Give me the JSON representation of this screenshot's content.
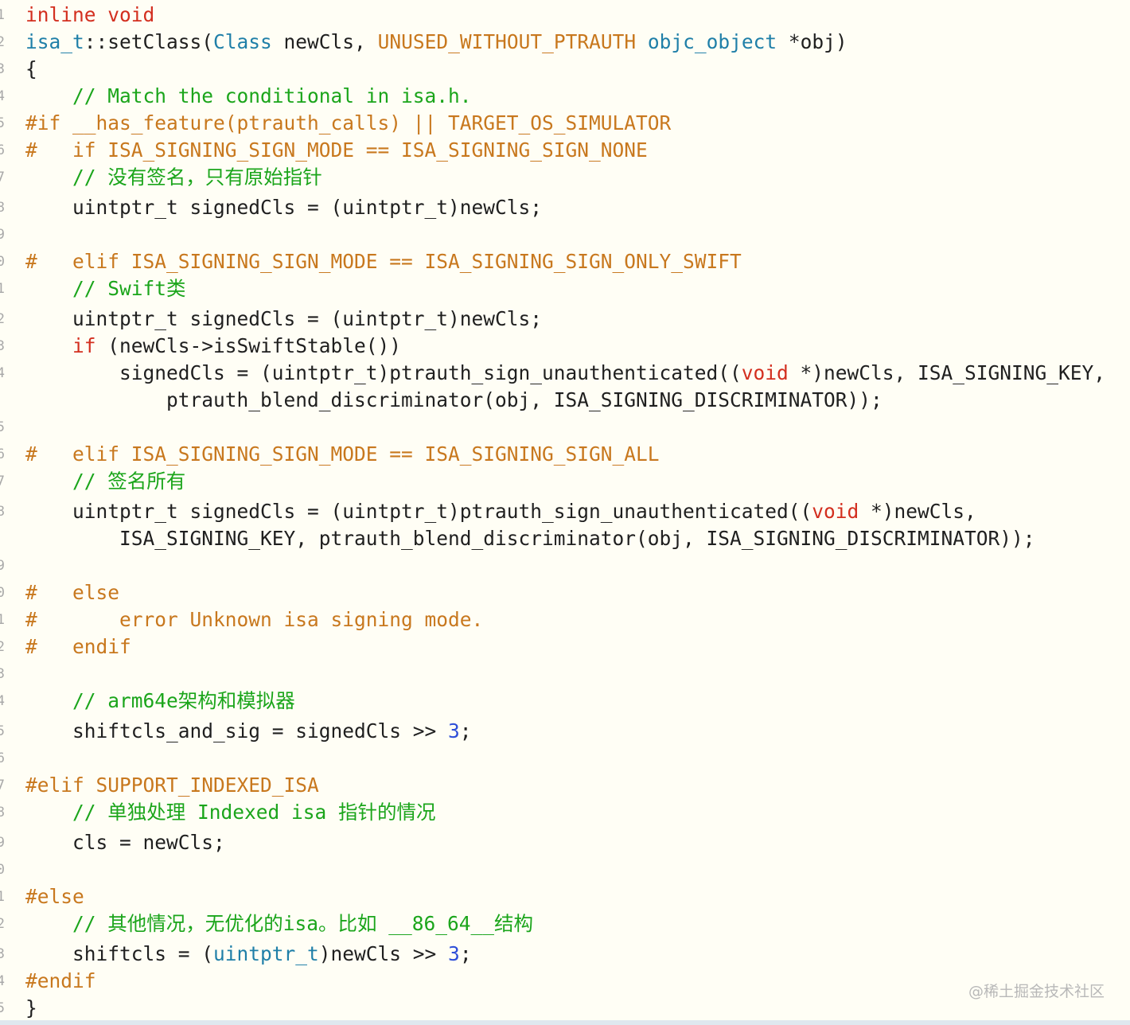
{
  "editor": {
    "lines": [
      {
        "n": "1",
        "tokens": [
          {
            "t": "inline void",
            "k": "keyword"
          }
        ]
      },
      {
        "n": "2",
        "tokens": [
          {
            "t": "isa_t",
            "k": "type"
          },
          {
            "t": "::setClass(",
            "k": "plain"
          },
          {
            "t": "Class",
            "k": "type"
          },
          {
            "t": " newCls, ",
            "k": "plain"
          },
          {
            "t": "UNUSED_WITHOUT_PTRAUTH",
            "k": "macro"
          },
          {
            "t": " ",
            "k": "plain"
          },
          {
            "t": "objc_object",
            "k": "type"
          },
          {
            "t": " *obj)",
            "k": "plain"
          }
        ]
      },
      {
        "n": "3",
        "tokens": [
          {
            "t": "{",
            "k": "plain"
          }
        ]
      },
      {
        "n": "4",
        "tokens": [
          {
            "t": "    // Match the conditional in isa.h.",
            "k": "comment"
          }
        ]
      },
      {
        "n": "5",
        "tokens": [
          {
            "t": "#if __has_feature(ptrauth_calls) || TARGET_OS_SIMULATOR",
            "k": "preproc"
          }
        ]
      },
      {
        "n": "6",
        "tokens": [
          {
            "t": "#   if ISA_SIGNING_SIGN_MODE == ISA_SIGNING_SIGN_NONE",
            "k": "preproc"
          }
        ]
      },
      {
        "n": "7",
        "tokens": [
          {
            "t": "    // 没有签名，只有原始指针",
            "k": "comment"
          }
        ]
      },
      {
        "n": "8",
        "tokens": [
          {
            "t": "    uintptr_t signedCls = (uintptr_t)newCls;",
            "k": "plain"
          }
        ]
      },
      {
        "n": "9",
        "tokens": []
      },
      {
        "n": "0",
        "tokens": [
          {
            "t": "#   elif ISA_SIGNING_SIGN_MODE == ISA_SIGNING_SIGN_ONLY_SWIFT",
            "k": "preproc"
          }
        ]
      },
      {
        "n": "1",
        "tokens": [
          {
            "t": "    // Swift类",
            "k": "comment"
          }
        ]
      },
      {
        "n": "2",
        "tokens": [
          {
            "t": "    uintptr_t signedCls = (uintptr_t)newCls;",
            "k": "plain"
          }
        ]
      },
      {
        "n": "3",
        "tokens": [
          {
            "t": "    ",
            "k": "plain"
          },
          {
            "t": "if",
            "k": "keyword"
          },
          {
            "t": " (newCls->isSwiftStable())",
            "k": "plain"
          }
        ]
      },
      {
        "n": "4",
        "tokens": [
          {
            "t": "        signedCls = (uintptr_t)ptrauth_sign_unauthenticated((",
            "k": "plain"
          },
          {
            "t": "void",
            "k": "keyword"
          },
          {
            "t": " *)newCls, ISA_SIGNING_KEY,",
            "k": "plain"
          }
        ]
      },
      {
        "n": "",
        "tokens": [
          {
            "t": "            ptrauth_blend_discriminator(obj, ISA_SIGNING_DISCRIMINATOR));",
            "k": "plain"
          }
        ]
      },
      {
        "n": "5",
        "tokens": []
      },
      {
        "n": "6",
        "tokens": [
          {
            "t": "#   elif ISA_SIGNING_SIGN_MODE == ISA_SIGNING_SIGN_ALL",
            "k": "preproc"
          }
        ]
      },
      {
        "n": "7",
        "tokens": [
          {
            "t": "    // 签名所有",
            "k": "comment"
          }
        ]
      },
      {
        "n": "8",
        "tokens": [
          {
            "t": "    uintptr_t signedCls = (uintptr_t)ptrauth_sign_unauthenticated((",
            "k": "plain"
          },
          {
            "t": "void",
            "k": "keyword"
          },
          {
            "t": " *)newCls,",
            "k": "plain"
          }
        ]
      },
      {
        "n": "",
        "tokens": [
          {
            "t": "        ISA_SIGNING_KEY, ptrauth_blend_discriminator(obj, ISA_SIGNING_DISCRIMINATOR));",
            "k": "plain"
          }
        ]
      },
      {
        "n": "9",
        "tokens": []
      },
      {
        "n": "0",
        "tokens": [
          {
            "t": "#   else",
            "k": "preproc"
          }
        ]
      },
      {
        "n": "1",
        "tokens": [
          {
            "t": "#       error Unknown isa signing mode.",
            "k": "preproc"
          }
        ]
      },
      {
        "n": "2",
        "tokens": [
          {
            "t": "#   endif",
            "k": "preproc"
          }
        ]
      },
      {
        "n": "3",
        "tokens": []
      },
      {
        "n": "4",
        "tokens": [
          {
            "t": "    // arm64e架构和模拟器",
            "k": "comment"
          }
        ]
      },
      {
        "n": "5",
        "tokens": [
          {
            "t": "    shiftcls_and_sig = signedCls >> ",
            "k": "plain"
          },
          {
            "t": "3",
            "k": "number"
          },
          {
            "t": ";",
            "k": "plain"
          }
        ]
      },
      {
        "n": "6",
        "tokens": []
      },
      {
        "n": "7",
        "tokens": [
          {
            "t": "#elif SUPPORT_INDEXED_ISA",
            "k": "preproc"
          }
        ]
      },
      {
        "n": "8",
        "tokens": [
          {
            "t": "    // 单独处理 Indexed isa 指针的情况",
            "k": "comment"
          }
        ]
      },
      {
        "n": "9",
        "tokens": [
          {
            "t": "    cls = newCls;",
            "k": "plain"
          }
        ]
      },
      {
        "n": "0",
        "tokens": []
      },
      {
        "n": "1",
        "tokens": [
          {
            "t": "#else",
            "k": "preproc"
          }
        ]
      },
      {
        "n": "2",
        "tokens": [
          {
            "t": "    // 其他情况，无优化的isa。比如 __86_64__结构",
            "k": "comment"
          }
        ]
      },
      {
        "n": "3",
        "tokens": [
          {
            "t": "    shiftcls = (",
            "k": "plain"
          },
          {
            "t": "uintptr_t",
            "k": "type"
          },
          {
            "t": ")newCls >> ",
            "k": "plain"
          },
          {
            "t": "3",
            "k": "number"
          },
          {
            "t": ";",
            "k": "plain"
          }
        ]
      },
      {
        "n": "4",
        "tokens": [
          {
            "t": "#endif",
            "k": "preproc"
          }
        ]
      },
      {
        "n": "5",
        "tokens": [
          {
            "t": "}",
            "k": "plain"
          }
        ]
      }
    ]
  },
  "watermark": {
    "text": "@稀土掘金技术社区"
  }
}
